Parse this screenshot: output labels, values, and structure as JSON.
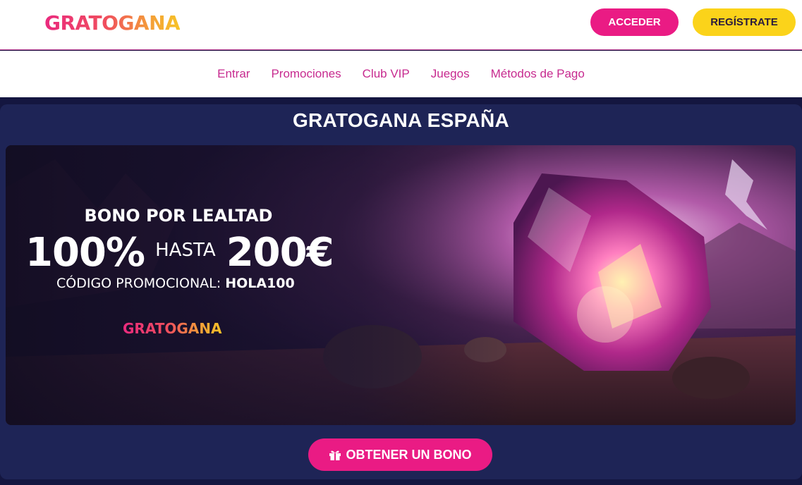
{
  "header": {
    "logo_text": "GRATOGANA",
    "login_label": "ACCEDER",
    "register_label": "REGÍSTRATE"
  },
  "nav": {
    "items": [
      "Entrar",
      "Promociones",
      "Club VIP",
      "Juegos",
      "Métodos de Pago"
    ]
  },
  "main": {
    "title": "GRATOGANA ESPAÑA",
    "banner": {
      "label": "BONO POR LEALTAD",
      "percent": "100%",
      "connector": "HASTA",
      "amount": "200€",
      "code_label": "CÓDIGO PROMOCIONAL:",
      "code_value": "HOLA100",
      "brand": "GRATOGANA"
    },
    "cta_label": "OBTENER UN BONO",
    "cta_icon": "gift-icon"
  },
  "colors": {
    "brand_pink": "#ea1b84",
    "brand_yellow": "#fbd31a",
    "nav_text": "#c72a8f",
    "page_bg": "#141640",
    "card_bg": "#1e2456"
  }
}
